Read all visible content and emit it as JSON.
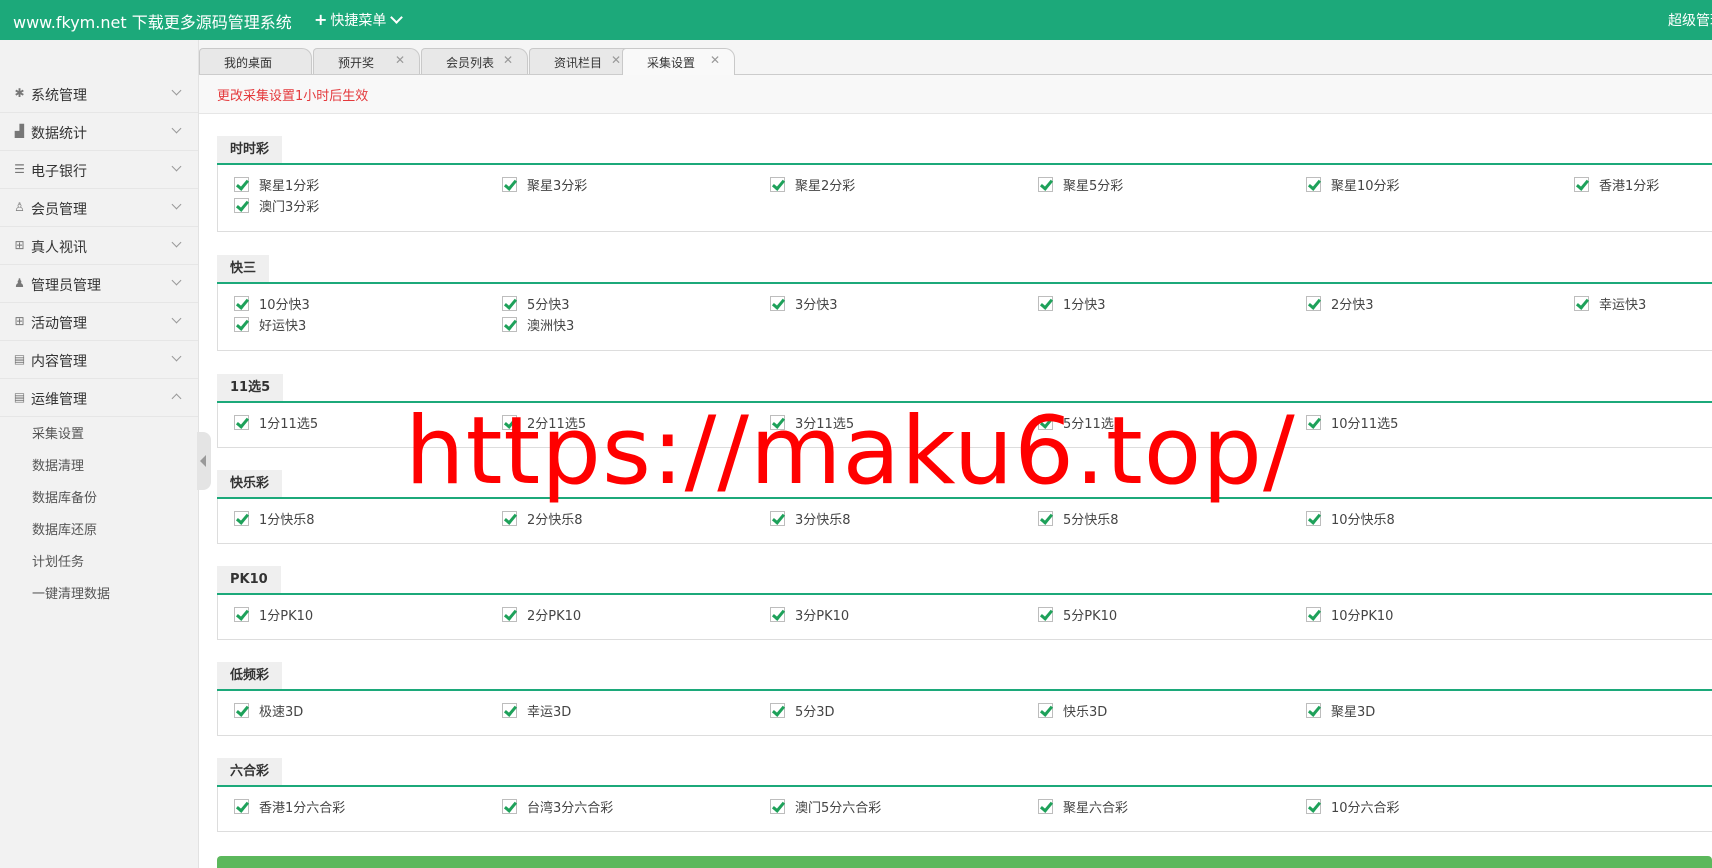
{
  "header": {
    "brand": "www.fkym.net 下载更多源码管理系统",
    "quick_menu": "快捷菜单",
    "user": "超级管理员"
  },
  "sidebar": {
    "items": [
      {
        "label": "系统管理",
        "icon": "gear-icon"
      },
      {
        "label": "数据统计",
        "icon": "bar-chart-icon"
      },
      {
        "label": "电子银行",
        "icon": "list-icon"
      },
      {
        "label": "会员管理",
        "icon": "user-icon"
      },
      {
        "label": "真人视讯",
        "icon": "gift-icon"
      },
      {
        "label": "管理员管理",
        "icon": "admin-user-icon"
      },
      {
        "label": "活动管理",
        "icon": "gift-icon"
      },
      {
        "label": "内容管理",
        "icon": "document-icon"
      },
      {
        "label": "运维管理",
        "icon": "document-icon"
      }
    ],
    "subitems": [
      "采集设置",
      "数据清理",
      "数据库备份",
      "数据库还原",
      "计划任务",
      "一键清理数据"
    ]
  },
  "tabs": [
    {
      "label": "我的桌面"
    },
    {
      "label": "预开奖"
    },
    {
      "label": "会员列表"
    },
    {
      "label": "资讯栏目"
    },
    {
      "label": "采集设置"
    }
  ],
  "notice": "更改采集设置1小时后生效",
  "groups": [
    {
      "title": "时时彩",
      "options": [
        "聚星1分彩",
        "聚星3分彩",
        "聚星2分彩",
        "聚星5分彩",
        "聚星10分彩",
        "香港1分彩",
        "澳门3分彩"
      ]
    },
    {
      "title": "快三",
      "options": [
        "10分快3",
        "5分快3",
        "3分快3",
        "1分快3",
        "2分快3",
        "幸运快3",
        "好运快3",
        "澳洲快3"
      ]
    },
    {
      "title": "11选5",
      "options": [
        "1分11选5",
        "2分11选5",
        "3分11选5",
        "5分11选5",
        "10分11选5"
      ]
    },
    {
      "title": "快乐彩",
      "options": [
        "1分快乐8",
        "2分快乐8",
        "3分快乐8",
        "5分快乐8",
        "10分快乐8"
      ]
    },
    {
      "title": "PK10",
      "options": [
        "1分PK10",
        "2分PK10",
        "3分PK10",
        "5分PK10",
        "10分PK10"
      ]
    },
    {
      "title": "低频彩",
      "options": [
        "极速3D",
        "幸运3D",
        "5分3D",
        "快乐3D",
        "聚星3D"
      ]
    },
    {
      "title": "六合彩",
      "options": [
        "香港1分六合彩",
        "台湾3分六合彩",
        "澳门5分六合彩",
        "聚星六合彩",
        "10分六合彩"
      ]
    }
  ],
  "watermark": "https://maku6.top/",
  "colors": {
    "accent": "#1ca97a",
    "notice": "#e4393c",
    "check": "#1ea15a",
    "submit": "#5cb85c"
  }
}
